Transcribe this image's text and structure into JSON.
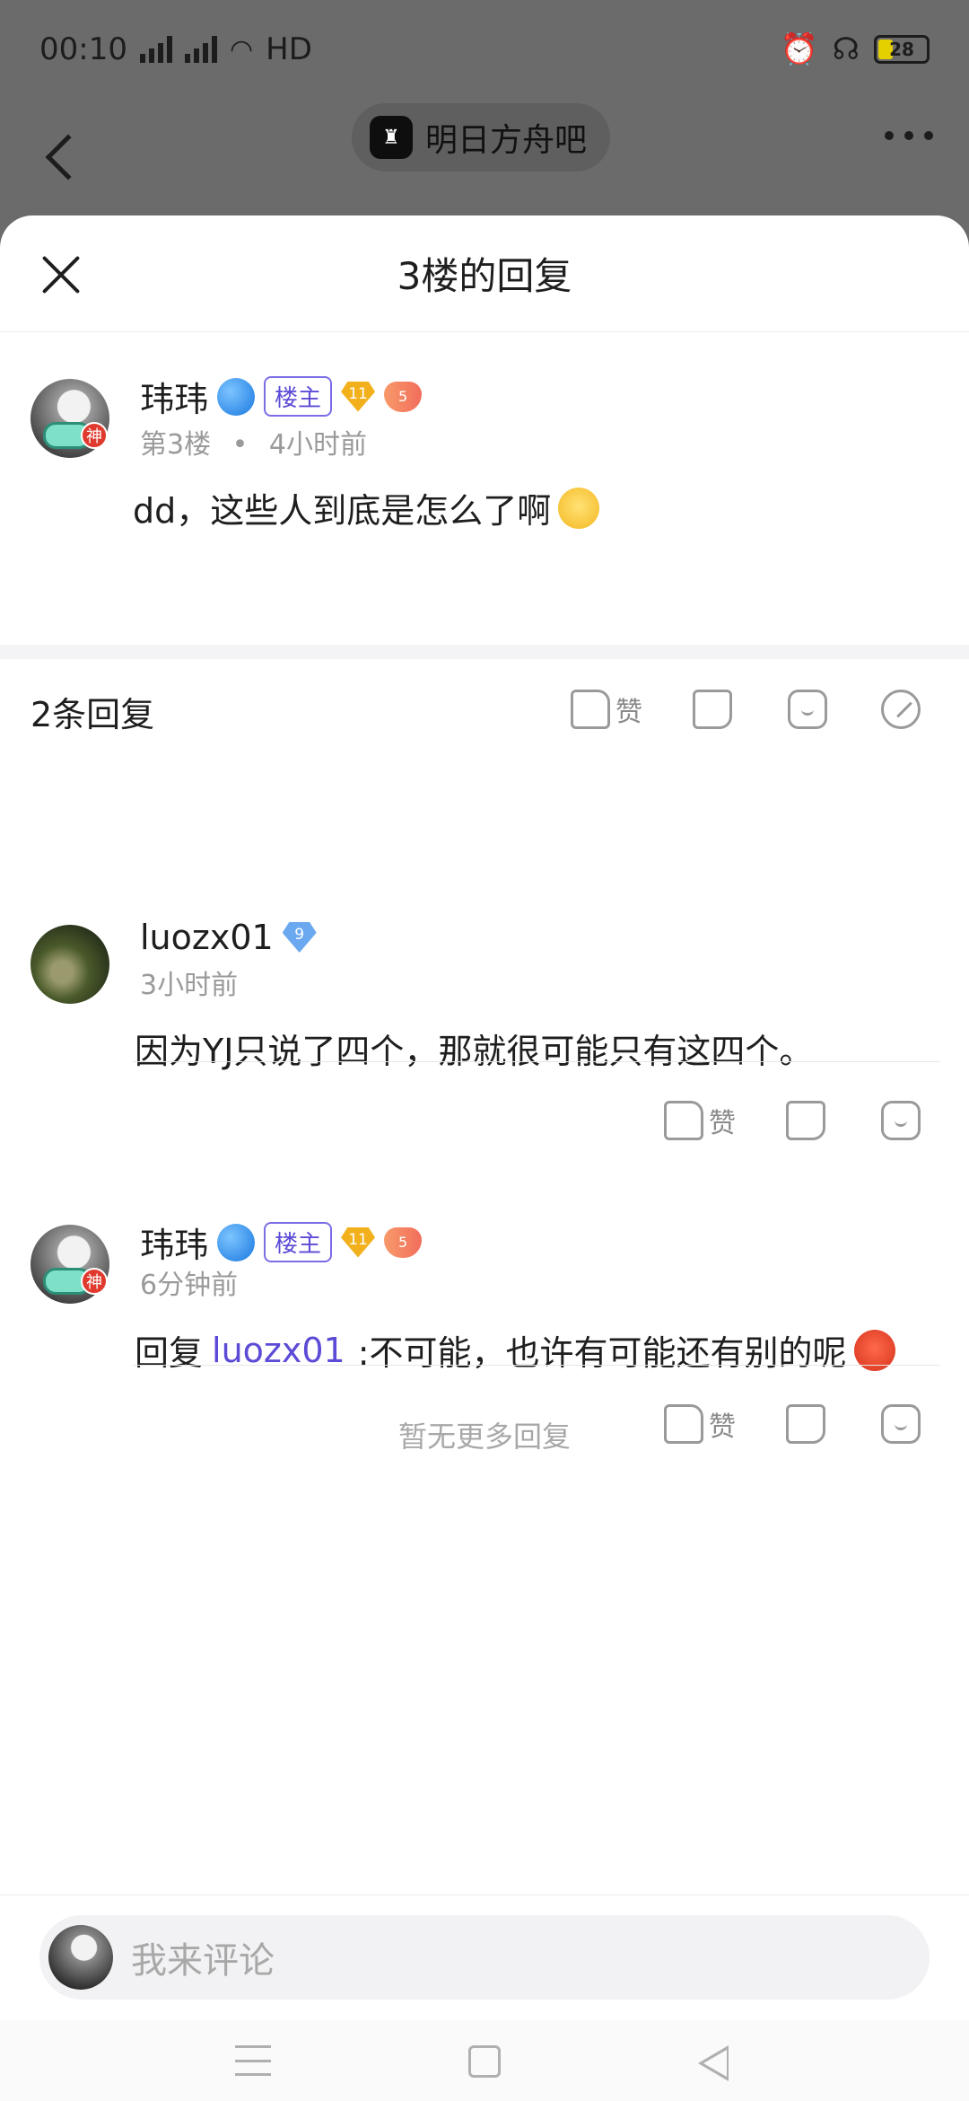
{
  "status_bar": {
    "time": "00:10",
    "network": "HD",
    "battery": "28"
  },
  "top_nav": {
    "forum_name": "明日方舟吧"
  },
  "sheet": {
    "title": "3楼的回复"
  },
  "main_comment": {
    "username": "玮玮",
    "host_badge": "楼主",
    "level": "11",
    "heart_level": "5",
    "god_badge": "神",
    "floor": "第3楼",
    "separator": "•",
    "time": "4小时前",
    "text": "dd，这些人到底是怎么了啊",
    "like_label": "赞"
  },
  "reply_count": "2条回复",
  "replies": [
    {
      "username": "luozx01",
      "level": "9",
      "time": "3小时前",
      "text": "因为YJ只说了四个，那就很可能只有这四个。",
      "like_label": "赞"
    },
    {
      "username": "玮玮",
      "host_badge": "楼主",
      "level": "11",
      "heart_level": "5",
      "god_badge": "神",
      "time": "6分钟前",
      "reply_prefix": "回复",
      "mention": "luozx01",
      "text": ":不可能，也许有可能还有别的呢",
      "like_label": "赞"
    }
  ],
  "no_more": "暂无更多回复",
  "input": {
    "placeholder": "我来评论"
  }
}
